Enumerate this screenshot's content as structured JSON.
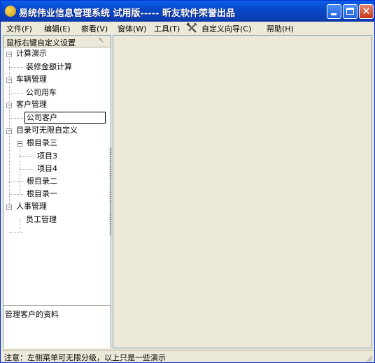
{
  "window": {
    "title": "易统伟业信息管理系统 试用版----- 昕友软件荣誉出品"
  },
  "menu": [
    {
      "label": "文件(F)"
    },
    {
      "label": "编辑(E)"
    },
    {
      "label": "察看(V)"
    },
    {
      "label": "窗体(W)"
    },
    {
      "label": "工具(T)"
    },
    {
      "label": "自定义向导(C)",
      "icon": "tools-icon"
    },
    {
      "label": "帮助(H)"
    }
  ],
  "sidebar": {
    "hint": "鼠标右键自定义设置",
    "tree": [
      {
        "label": "计算演示",
        "level": 0,
        "expander": "−"
      },
      {
        "label": "装修金额计算",
        "level": 1
      },
      {
        "label": "车辆管理",
        "level": 0,
        "expander": "−"
      },
      {
        "label": "公司用车",
        "level": 1
      },
      {
        "label": "客户管理",
        "level": 0,
        "expander": "−"
      },
      {
        "label": "公司客户",
        "level": 1,
        "selected": true
      },
      {
        "label": "目录可无限自定义",
        "level": 0,
        "expander": "−"
      },
      {
        "label": "根目录三",
        "level": 1,
        "expander": "−"
      },
      {
        "label": "项目3",
        "level": 2
      },
      {
        "label": "项目4",
        "level": 2
      },
      {
        "label": "根目录二",
        "level": 1
      },
      {
        "label": "根目录一",
        "level": 1
      },
      {
        "label": "人事管理",
        "level": 0,
        "expander": "−"
      },
      {
        "label": "员工管理",
        "level": 1
      }
    ],
    "description": "管理客户的资料"
  },
  "status": {
    "text": "注意：左侧菜单可无限分级，以上只是一些演示"
  },
  "colors": {
    "titlebar": "#0a5fe8",
    "border": "#0831d9",
    "face": "#ece9d8",
    "pane_border": "#7f9db9"
  }
}
